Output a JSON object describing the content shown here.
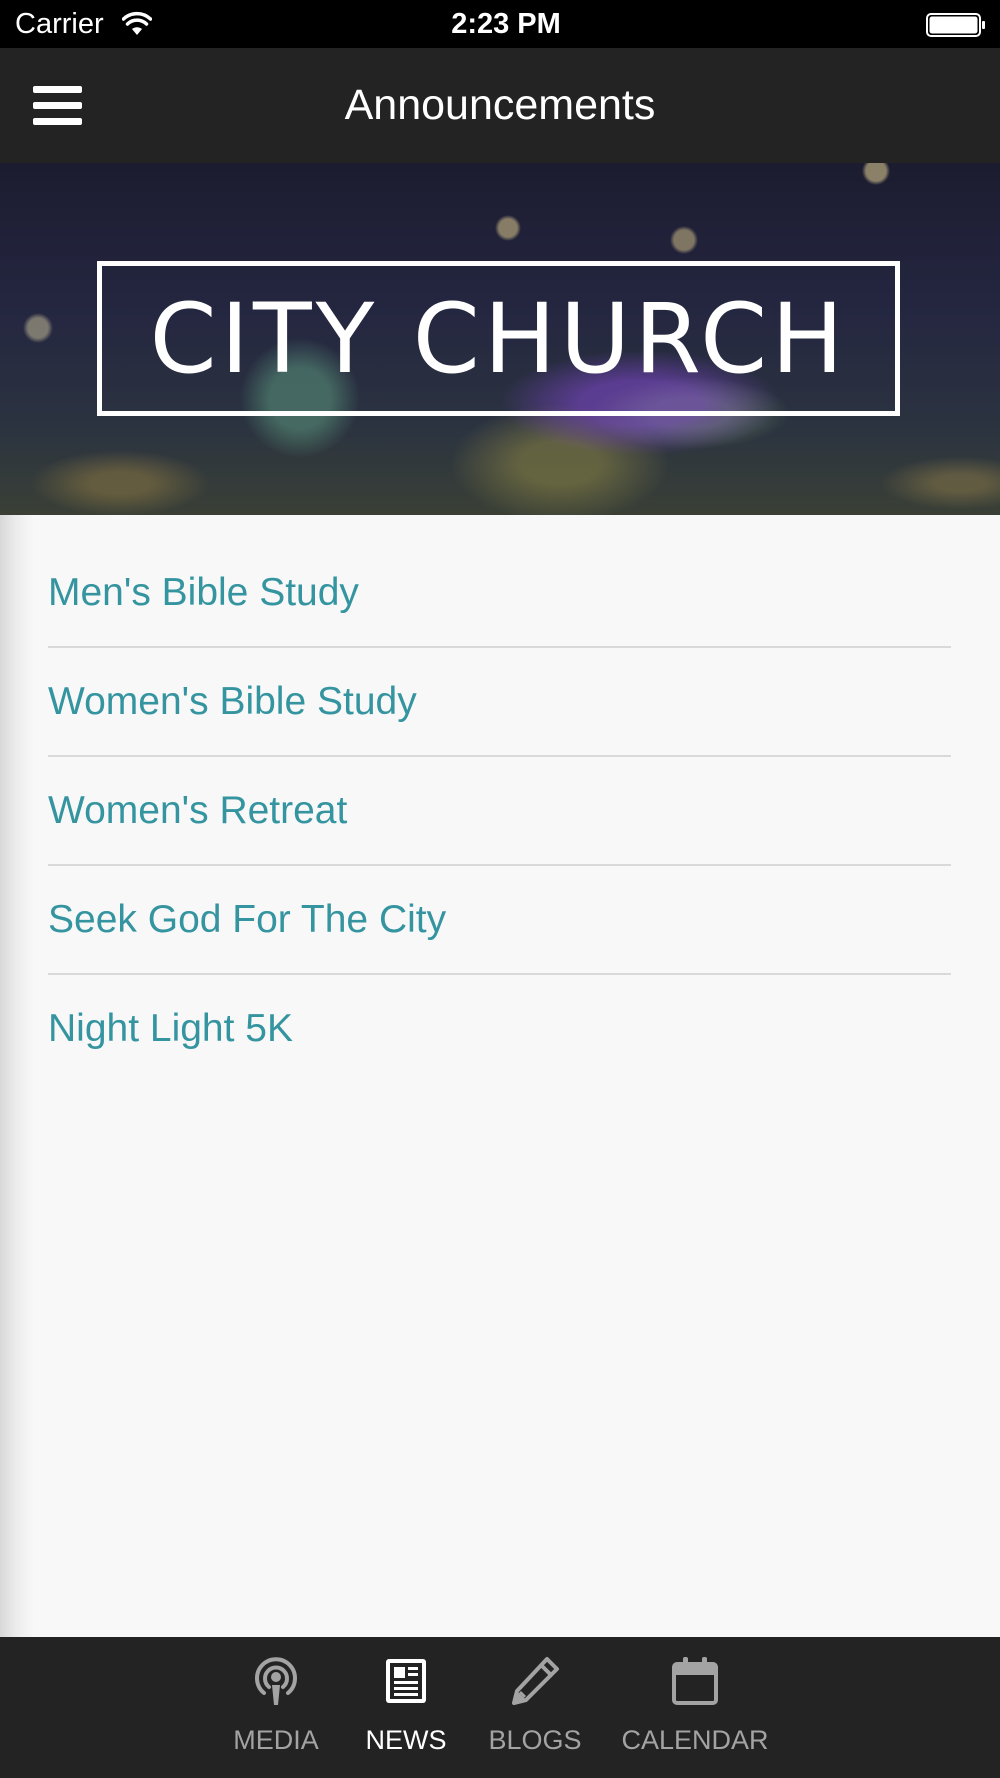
{
  "status_bar": {
    "carrier": "Carrier",
    "time": "2:23 PM",
    "wifi_icon": "wifi-icon",
    "battery_icon": "battery-icon"
  },
  "nav_bar": {
    "title": "Announcements",
    "menu_icon": "hamburger-menu-icon"
  },
  "hero": {
    "logo_text": "CITY CHURCH"
  },
  "announcements": {
    "items": [
      {
        "label": "Men's Bible Study"
      },
      {
        "label": "Women's Bible Study"
      },
      {
        "label": "Women's Retreat"
      },
      {
        "label": "Seek God For The City"
      },
      {
        "label": "Night Light 5K"
      }
    ]
  },
  "tab_bar": {
    "active_tab": "NEWS",
    "tabs": [
      {
        "label": "MEDIA",
        "icon": "podcast-icon"
      },
      {
        "label": "NEWS",
        "icon": "newspaper-icon"
      },
      {
        "label": "BLOGS",
        "icon": "pencil-icon"
      },
      {
        "label": "CALENDAR",
        "icon": "calendar-icon"
      }
    ]
  },
  "colors": {
    "status_bar_bg": "#000000",
    "nav_bar_bg": "#232323",
    "tab_bar_bg": "#232323",
    "list_text": "#3494a0",
    "content_bg": "#f8f8f8",
    "tab_inactive": "#a3a3a3",
    "tab_active": "#ffffff"
  }
}
